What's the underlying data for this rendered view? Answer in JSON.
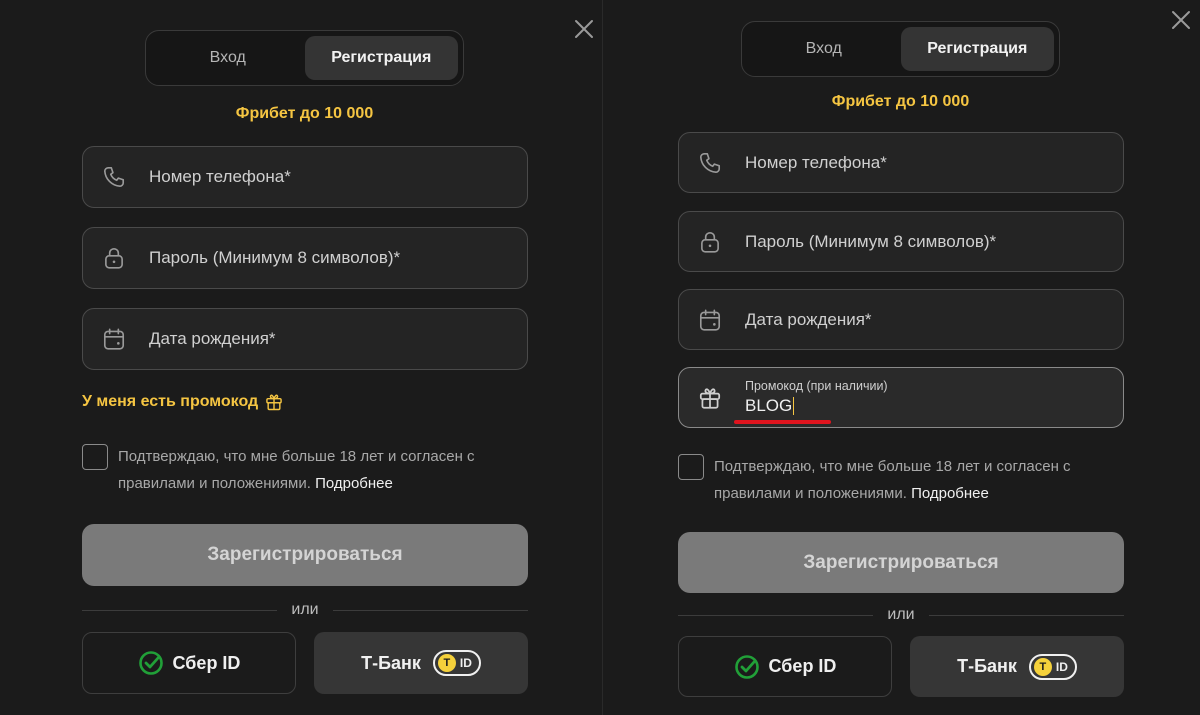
{
  "colors": {
    "accent": "#f5c542",
    "sber_green": "#21a038",
    "underline_red": "#e0141e",
    "tbank_yellow": "#f5d13b"
  },
  "left": {
    "tabs": {
      "login": "Вход",
      "register": "Регистрация"
    },
    "freebet": "Фрибет до 10 000",
    "fields": {
      "phone": "Номер телефона*",
      "password": "Пароль (Минимум 8 символов)*",
      "birthdate": "Дата рождения*"
    },
    "promo_link": "У меня есть промокод",
    "consent": {
      "text": "Подтверждаю, что мне больше 18 лет и согласен с правилами и положениями.",
      "more": "Подробнее"
    },
    "submit": "Зарегистрироваться",
    "or": "или",
    "social": {
      "sber": "Сбер ID",
      "tbank": "Т-Банк",
      "tbank_badge": "ID"
    }
  },
  "right": {
    "tabs": {
      "login": "Вход",
      "register": "Регистрация"
    },
    "freebet": "Фрибет до 10 000",
    "fields": {
      "phone": "Номер телефона*",
      "password": "Пароль (Минимум 8 символов)*",
      "birthdate": "Дата рождения*",
      "promo_label": "Промокод (при наличии)",
      "promo_value": "BLOG"
    },
    "consent": {
      "text": "Подтверждаю, что мне больше 18 лет и согласен с правилами и положениями.",
      "more": "Подробнее"
    },
    "submit": "Зарегистрироваться",
    "or": "или",
    "social": {
      "sber": "Сбер ID",
      "tbank": "Т-Банк",
      "tbank_badge": "ID"
    }
  },
  "icons": [
    "close-icon",
    "phone-icon",
    "lock-icon",
    "calendar-icon",
    "gift-icon",
    "sber-logo-icon",
    "tbank-shield-icon"
  ]
}
